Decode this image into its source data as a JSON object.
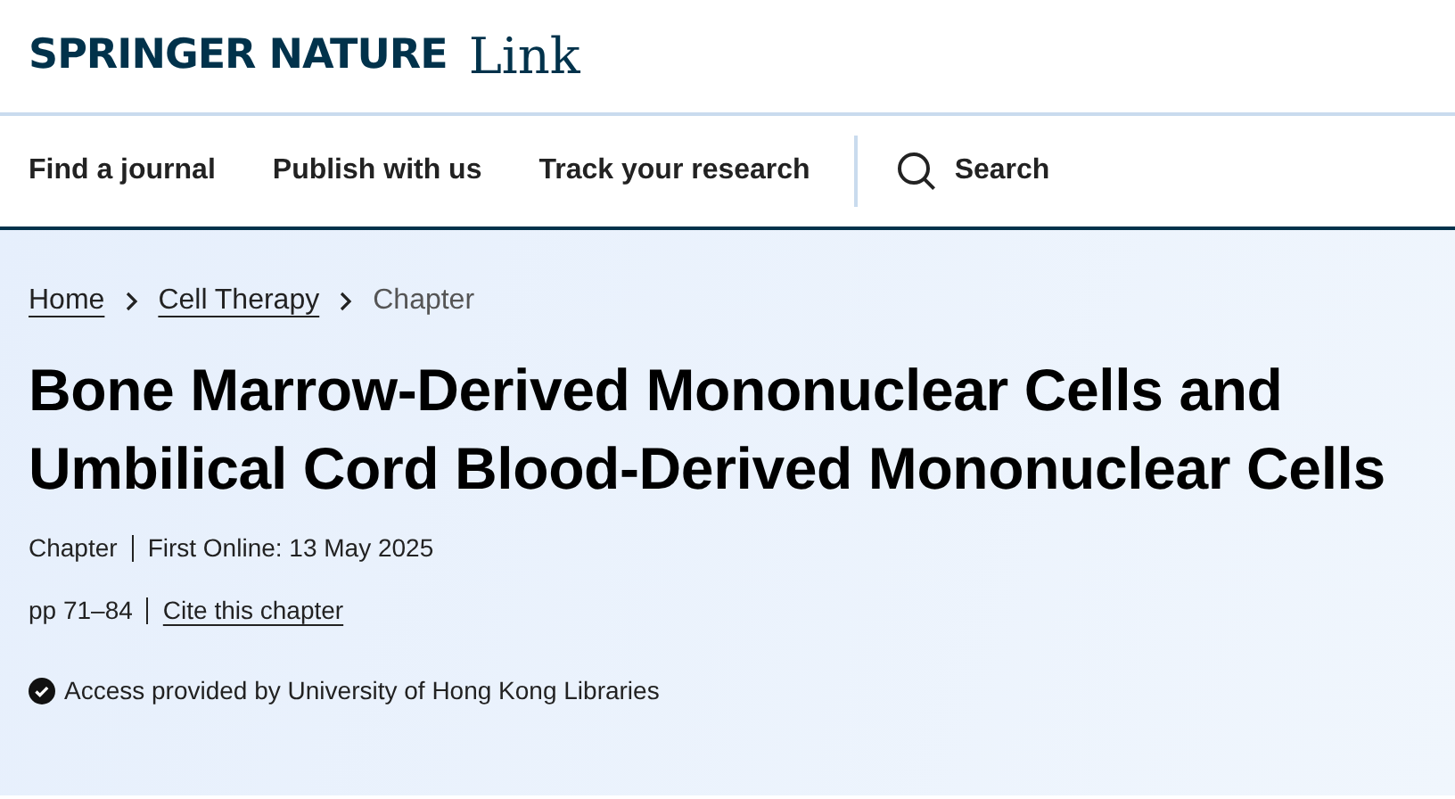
{
  "header": {
    "logo": {
      "brand": "SPRINGER NATURE",
      "product": "Link"
    }
  },
  "nav": {
    "items": [
      "Find a journal",
      "Publish with us",
      "Track your research"
    ],
    "search": "Search"
  },
  "breadcrumb": [
    {
      "label": "Home",
      "kind": "link"
    },
    {
      "label": "Cell Therapy",
      "kind": "link"
    },
    {
      "label": "Chapter",
      "kind": "current"
    }
  ],
  "title": "Bone Marrow-Derived Mononuclear Cells and Umbilical Cord Blood-Derived Mononuclear Cells",
  "meta": [
    [
      {
        "text": "Chapter",
        "kind": "text"
      },
      {
        "text": "First Online: 13 May 2025",
        "kind": "text"
      }
    ],
    [
      {
        "text": "pp 71–84",
        "kind": "text"
      },
      {
        "text": "Cite this chapter",
        "kind": "link"
      }
    ]
  ],
  "access": "Access provided by University of Hong Kong Libraries"
}
